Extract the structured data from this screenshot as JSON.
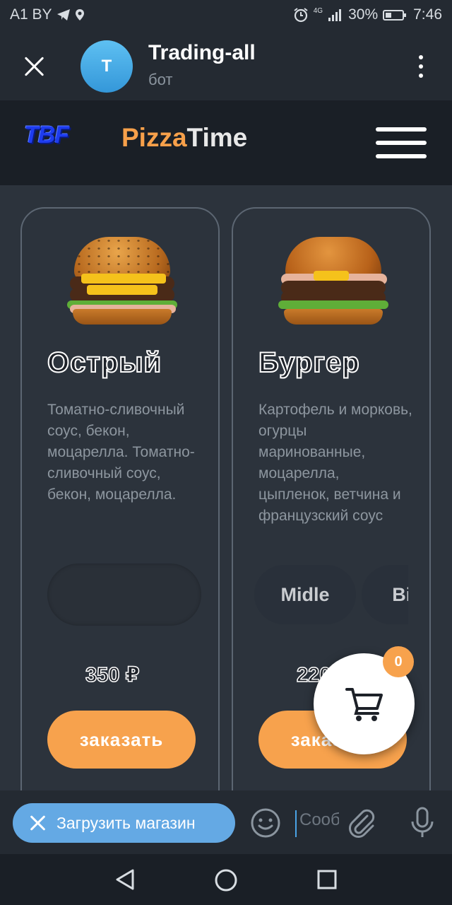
{
  "status_bar": {
    "carrier": "A1 BY",
    "network": "4G",
    "battery": "30%",
    "time": "7:46"
  },
  "chat_header": {
    "avatar_letter": "T",
    "title": "Trading-all",
    "subtitle": "бот"
  },
  "app_header": {
    "partner_logo": "TBF",
    "brand_part1": "Pizza",
    "brand_part2": "Time"
  },
  "products": [
    {
      "title": "Острый",
      "description": "Томатно-сливочный соус, бекон, моцарелла. Томатно-сливочный соус, бекон, моцарелла.",
      "sizes": [],
      "price": "350 ₽",
      "order_label": "заказать"
    },
    {
      "title": "Бургер",
      "description": "Картофель и морковь, огурцы маринованные, моцарелла, цыпленок, ветчина и французский соус",
      "sizes": [
        "Midle",
        "Big"
      ],
      "price": "220 ₽",
      "order_label": "заказать"
    }
  ],
  "cart": {
    "count": "0",
    "icon": "shopping-cart-icon"
  },
  "input_bar": {
    "bot_button_label": "Загрузить магазин",
    "message_placeholder": "Сообщение"
  },
  "colors": {
    "accent": "#f7a24d",
    "background": "#2c333c",
    "header": "#1a1f26",
    "telegram_blue": "#64a9e4"
  }
}
